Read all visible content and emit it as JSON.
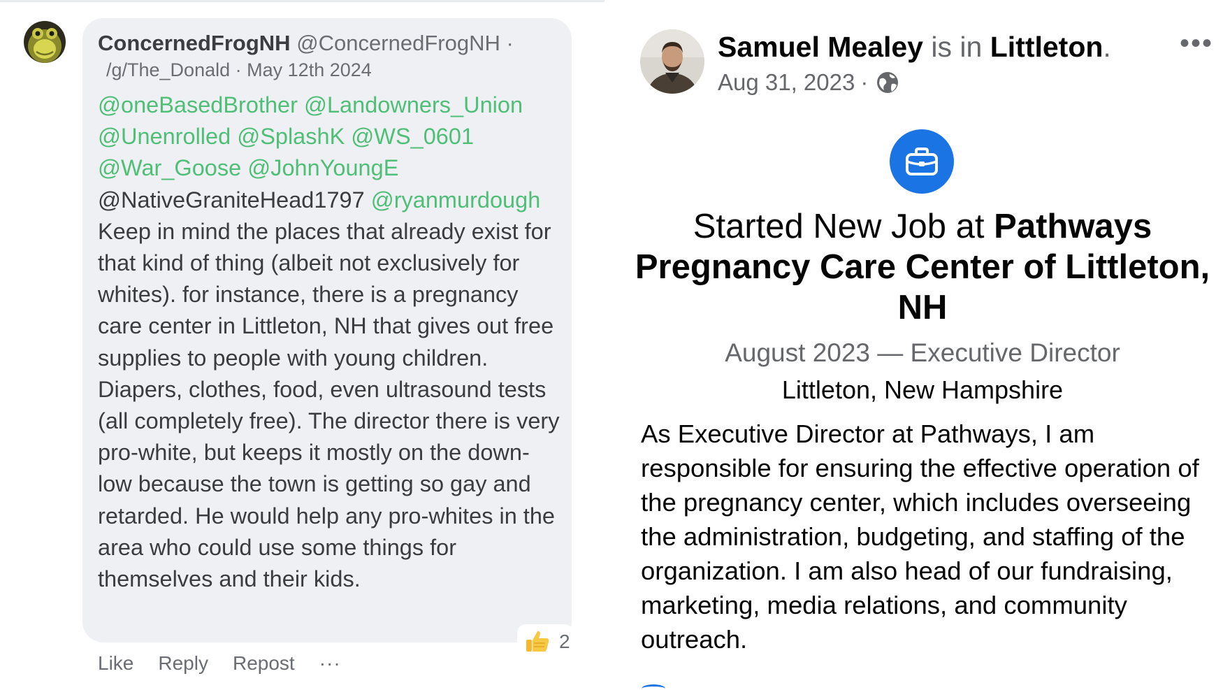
{
  "comment": {
    "avatar_icon": "frog-avatar-icon",
    "author_name": "ConcernedFrogNH",
    "author_handle": "@ConcernedFrogNH",
    "dot": "·",
    "community": "/g/The_Donald",
    "meta_separator": "·",
    "date": "May 12th 2024",
    "mentions_green_1": [
      "@oneBasedBrother",
      "@Landowners_Union",
      "@Unenrolled",
      "@SplashK",
      "@WS_0601",
      "@War_Goose",
      "@JohnYoungE"
    ],
    "mention_plain": "@NativeGraniteHead1797",
    "mention_green_last": "@ryanmurdough",
    "body_text": " Keep in mind the places that already exist for that kind of thing (albeit not exclusively for whites). for instance, there is a pregnancy care center in Littleton, NH that gives out free supplies to people with young children. Diapers, clothes, food, even ultrasound tests (all completely free). The director there is very pro-white, but keeps it mostly on the down-low because the town is getting so gay and retarded. He would help any pro-whites in the area who could use some things for themselves and their kids.",
    "reaction_icon": "thumbs-up-icon",
    "reaction_count": "2",
    "actions": {
      "like": "Like",
      "reply": "Reply",
      "repost": "Repost",
      "more": "···"
    }
  },
  "post": {
    "avatar_icon": "person-avatar-icon",
    "author_name": "Samuel Mealey",
    "is_in": "is in",
    "place": "Littleton",
    "period": ".",
    "date": "Aug 31, 2023",
    "date_separator": "·",
    "privacy_icon": "globe-icon",
    "more_button": "•••",
    "event_icon": "briefcase-icon",
    "title_prefix": "Started New Job at ",
    "title_org": "Pathways Pregnancy Care Center of Littleton, NH",
    "role_line": "August 2023 — Executive Director",
    "location_line": "Littleton, New Hampshire",
    "description": "As Executive Director at Pathways, I am responsible for ensuring the effective operation of the pregnancy center, which includes overseeing the administration, budgeting, and staffing of the organization. I am also head of our fundraising, marketing, media relations, and community outreach."
  },
  "colors": {
    "mention_green": "#4fbf77",
    "bubble_bg": "#eff0f3",
    "facebook_blue": "#1b74e4",
    "muted_text": "#65676b"
  }
}
